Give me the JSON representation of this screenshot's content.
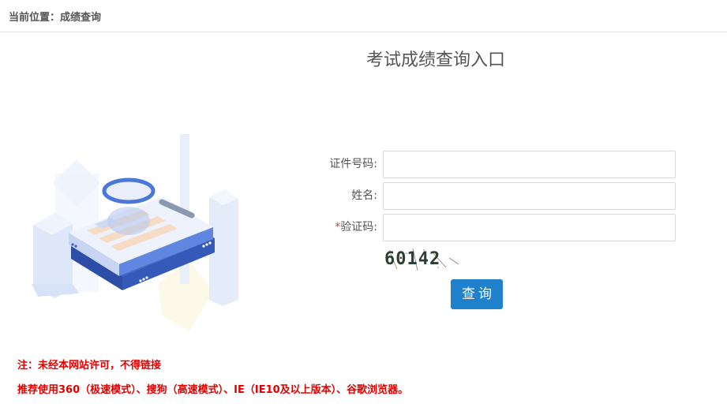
{
  "breadcrumb": {
    "text": "当前位置：成绩查询"
  },
  "page": {
    "title": "考试成绩查询入口"
  },
  "form": {
    "id_number": {
      "label": "证件号码:",
      "value": ""
    },
    "name": {
      "label": "姓名:",
      "value": ""
    },
    "captcha": {
      "required_mark": "*",
      "label": "验证码:",
      "value": ""
    },
    "captcha_image_text": "60142",
    "submit_label": "查询"
  },
  "notices": {
    "line1": "注：未经本网站许可，不得链接",
    "line2": "推荐使用360（极速模式）、搜狗（高速模式）、IE（IE10及以上版本）、谷歌浏览器。"
  },
  "colors": {
    "primary_button": "#1f80cc",
    "notice_text": "#e00000",
    "required_mark": "#e0353b"
  },
  "icons": {
    "illustration": "magnifier-over-documents-illustration"
  }
}
